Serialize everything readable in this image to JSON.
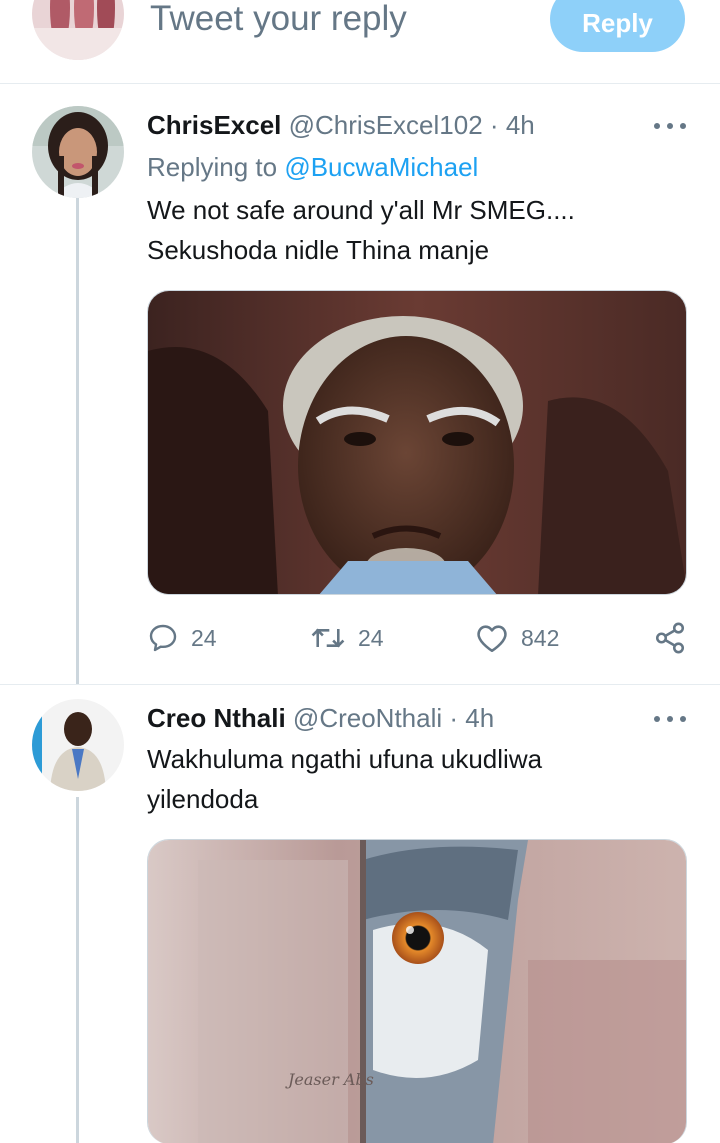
{
  "composer": {
    "placeholder": "Tweet your reply",
    "reply_label": "Reply"
  },
  "tweets": [
    {
      "name": "ChrisExcel",
      "handle": "@ChrisExcel102",
      "separator": "·",
      "time": "4h",
      "replying_prefix": "Replying to",
      "replying_to": "@BucwaMichael",
      "text_lines": [
        "We not safe around y'all Mr SMEG....",
        "Sekushoda nidle Thina manje"
      ],
      "media_icon": "photo-portrait-elderly-man",
      "replies": "24",
      "retweets": "24",
      "likes": "842"
    },
    {
      "name": "Creo Nthali",
      "handle": "@CreoNthali",
      "separator": "·",
      "time": "4h",
      "text_lines": [
        "Wakhuluma ngathi ufuna ukudliwa",
        "yilendoda"
      ],
      "media_icon": "photo-owl-peeking",
      "media_watermark": "Jeaser Abs"
    }
  ],
  "colors": {
    "accent": "#1da1f2",
    "reply_button": "#8ed0f9",
    "secondary_text": "#657786",
    "thread_line": "#ccd6dd"
  },
  "icons": [
    "reply-icon",
    "retweet-icon",
    "like-icon",
    "share-icon",
    "more-icon"
  ]
}
